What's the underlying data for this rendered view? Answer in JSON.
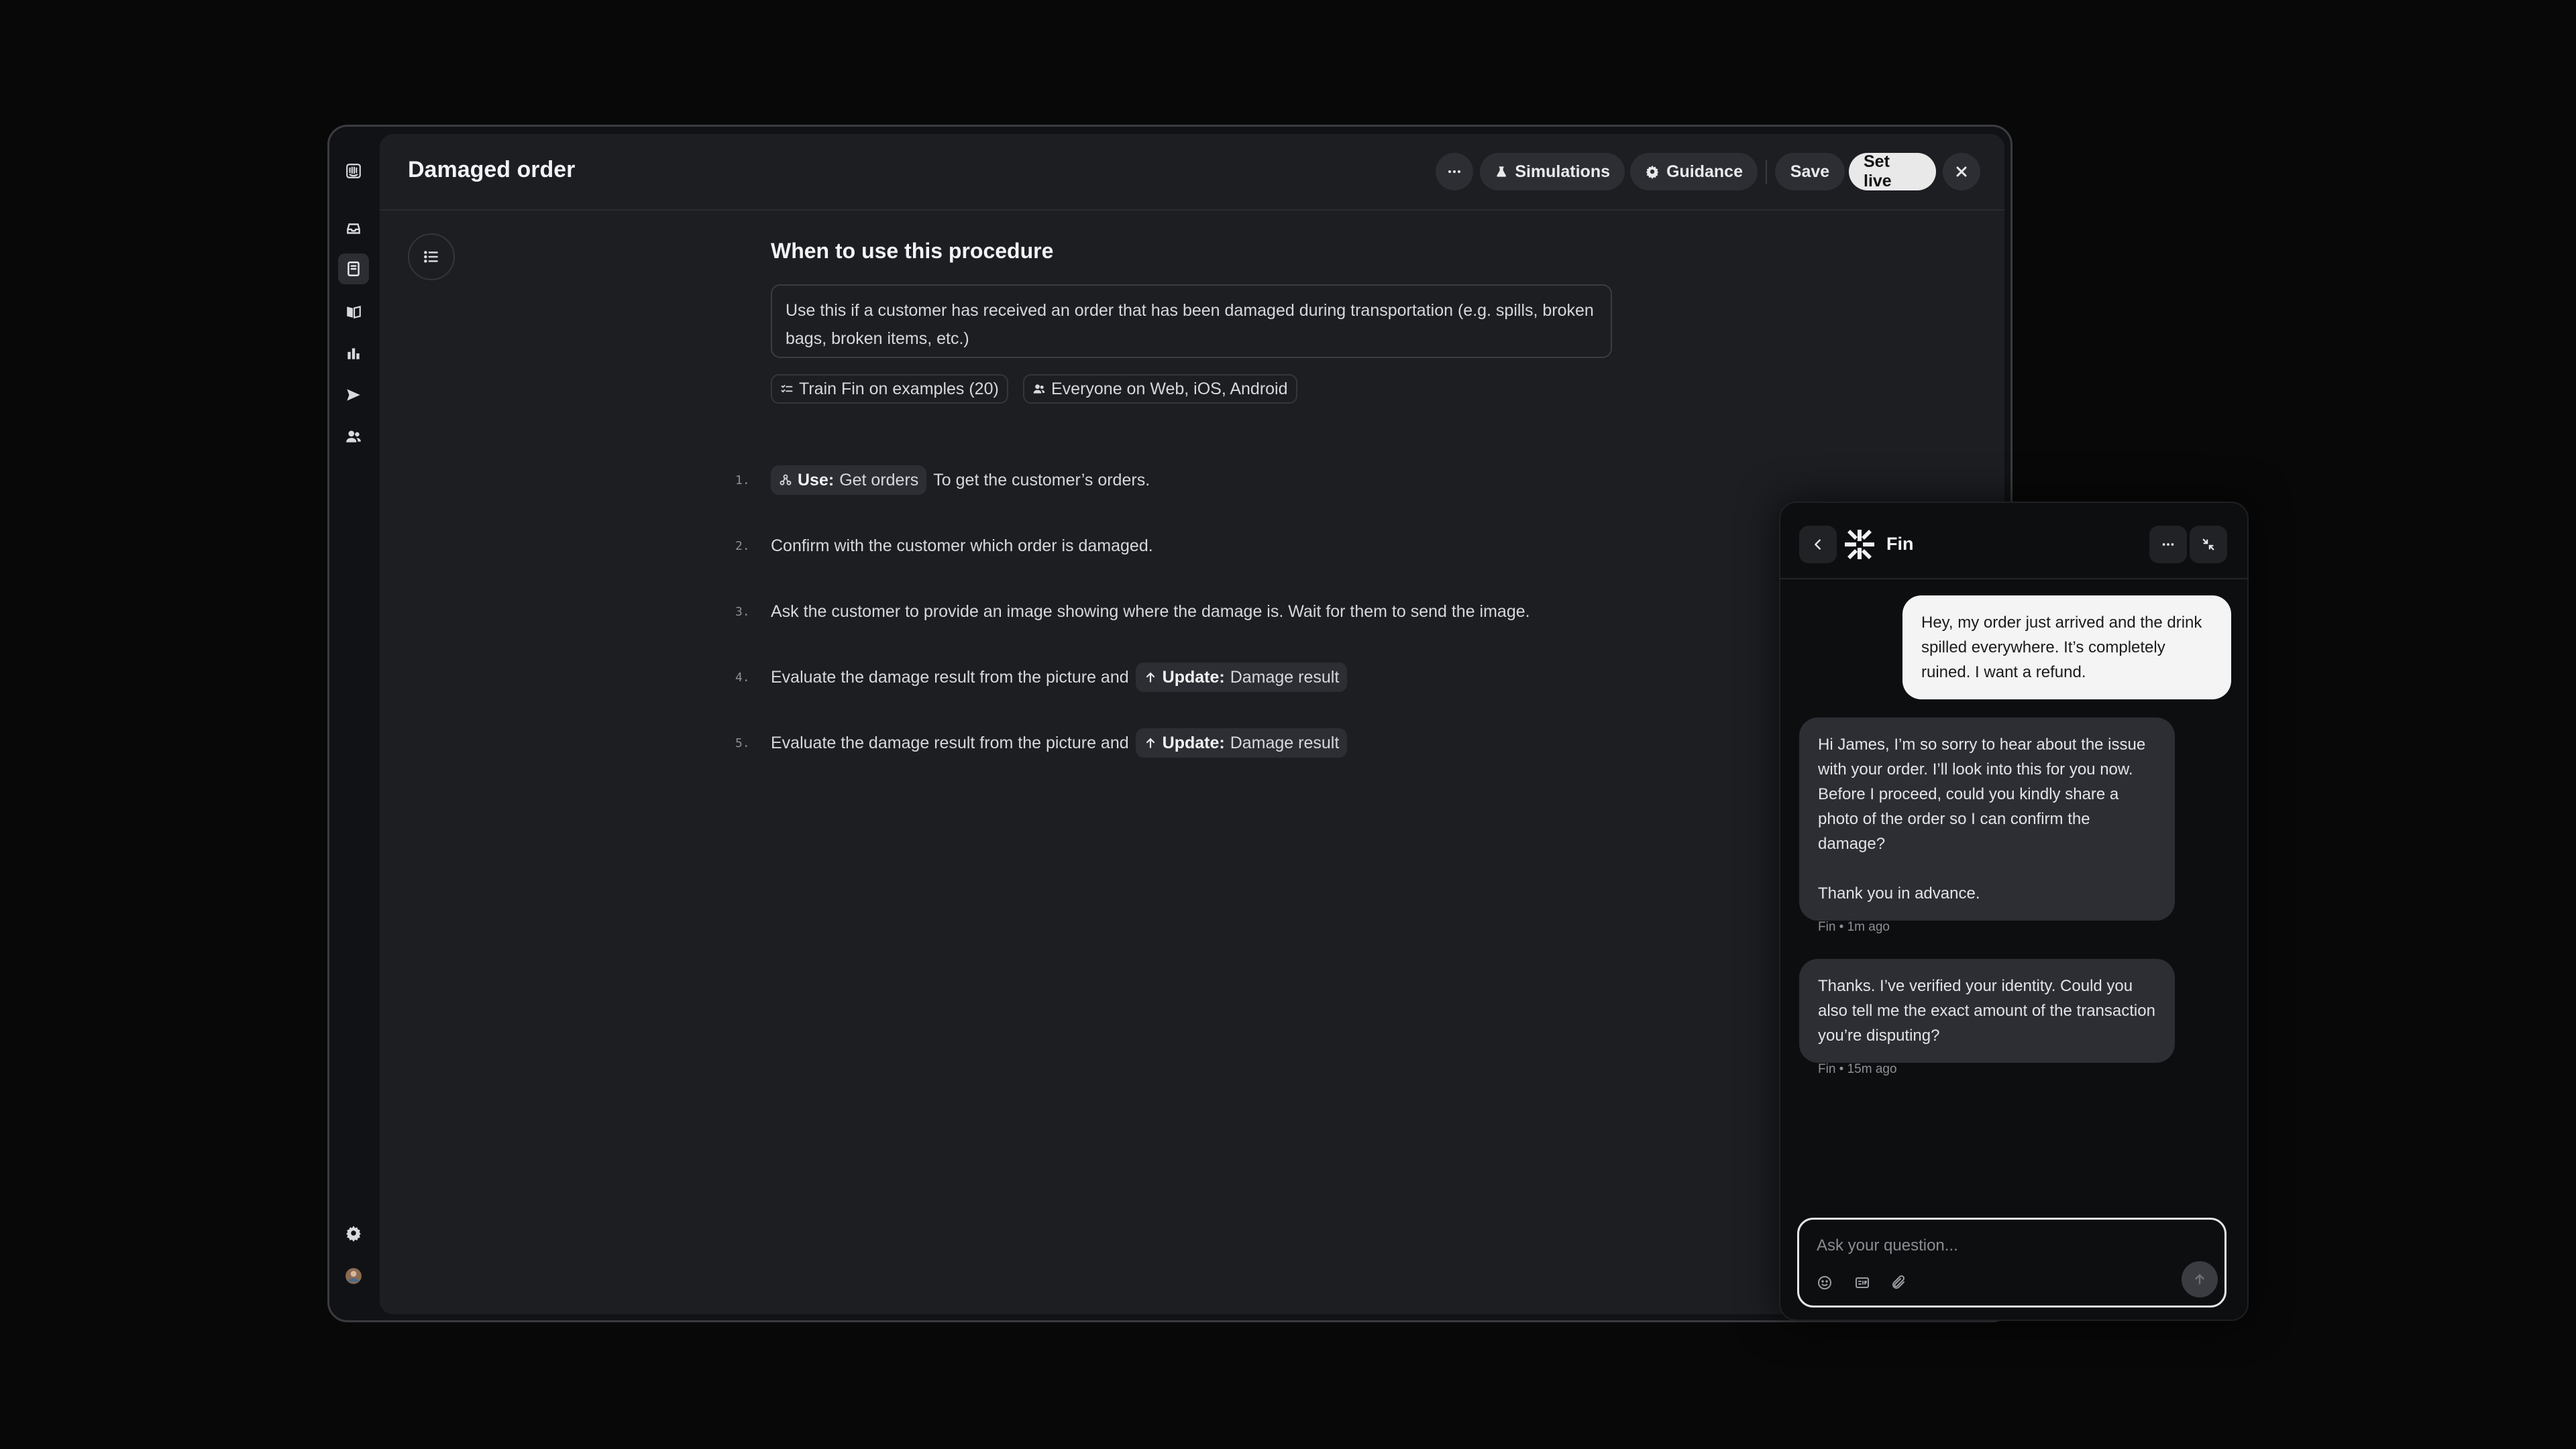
{
  "colors": {
    "app_bg": "#1c1e22",
    "frame_border": "#3b3c40",
    "pill_bg": "#2c2e33",
    "set_live_bg": "#e9e9ea",
    "chat_bg": "#0d0e10"
  },
  "rail": {
    "icons": [
      "app-logo-icon",
      "inbox-icon",
      "procedures-icon",
      "knowledge-icon",
      "reports-icon",
      "outbound-icon",
      "contacts-icon",
      "settings-icon",
      "user-avatar"
    ]
  },
  "header": {
    "title": "Damaged order",
    "simulations_label": "Simulations",
    "guidance_label": "Guidance",
    "save_label": "Save",
    "set_live_label": "Set live"
  },
  "procedure": {
    "section_title": "When to use this procedure",
    "description": "Use this if a customer has received an order that has been damaged during transportation (e.g. spills, broken bags, broken items, etc.)",
    "chips": {
      "train_label": "Train Fin on examples (20)",
      "audience_label": "Everyone on Web, iOS, Android"
    },
    "steps": [
      {
        "num": "1.",
        "pill_bold": "Use:",
        "pill_text": "Get orders",
        "text": "To get the customer’s orders."
      },
      {
        "num": "2.",
        "text": "Confirm with the customer which order is damaged."
      },
      {
        "num": "3.",
        "text": "Ask the customer to provide an image showing where the damage is. Wait for them to send the image."
      },
      {
        "num": "4.",
        "text": "Evaluate the damage result from the picture and",
        "pill_bold": "Update:",
        "pill_text": "Damage result"
      },
      {
        "num": "5.",
        "text": "Evaluate the damage result from the picture and",
        "pill_bold": "Update:",
        "pill_text": "Damage result"
      }
    ]
  },
  "chat": {
    "name": "Fin",
    "messages": [
      {
        "from": "user",
        "text": "Hey, my order just arrived and the drink spilled everywhere. It’s completely ruined. I want a refund."
      },
      {
        "from": "bot",
        "text": "Hi James, I’m so sorry to hear about the issue with your order. I’ll look into this for you now. Before I proceed, could you kindly share a photo of the order so I can confirm the damage?\n\nThank you in advance.",
        "meta": "Fin • 1m ago"
      },
      {
        "from": "bot",
        "text": "Thanks. I’ve verified your identity. Could you also tell me the exact amount of the transaction you’re disputing?",
        "meta": "Fin • 15m ago"
      }
    ],
    "composer": {
      "placeholder": "Ask your question...",
      "value": ""
    }
  }
}
